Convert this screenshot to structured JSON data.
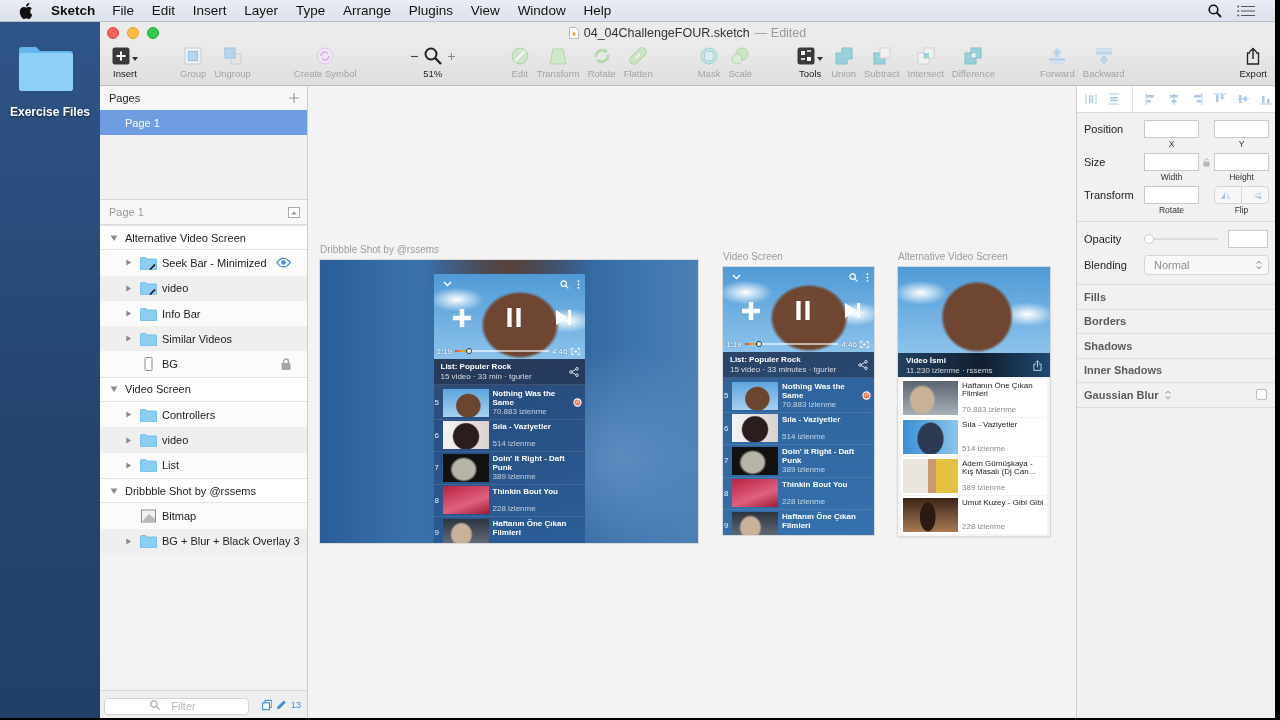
{
  "menu_bar": {
    "app_name": "Sketch",
    "menus": [
      "File",
      "Edit",
      "Insert",
      "Layer",
      "Type",
      "Arrange",
      "Plugins",
      "View",
      "Window",
      "Help"
    ]
  },
  "desktop": {
    "folder_label": "Exercise Files"
  },
  "window": {
    "title": "04_04ChallengeFOUR.sketch",
    "status": "— Edited"
  },
  "toolbar": {
    "groups": [
      {
        "items": [
          {
            "kind": "button",
            "label": "Insert",
            "disabled": false,
            "dropdown": true
          }
        ]
      },
      {
        "items": [
          {
            "kind": "button",
            "label": "Group",
            "disabled": true,
            "dropdown": false
          },
          {
            "kind": "button",
            "label": "Ungroup",
            "disabled": true,
            "dropdown": false
          }
        ]
      },
      {
        "items": [
          {
            "kind": "button",
            "label": "Create Symbol",
            "disabled": true,
            "dropdown": false
          }
        ]
      },
      {
        "items": [
          {
            "kind": "zoom",
            "label": "51%"
          }
        ]
      },
      {
        "items": [
          {
            "kind": "button",
            "label": "Edit",
            "disabled": true,
            "dropdown": false
          },
          {
            "kind": "button",
            "label": "Transform",
            "disabled": true,
            "dropdown": false
          },
          {
            "kind": "button",
            "label": "Rotate",
            "disabled": true,
            "dropdown": false
          },
          {
            "kind": "button",
            "label": "Flatten",
            "disabled": true,
            "dropdown": false
          }
        ]
      },
      {
        "items": [
          {
            "kind": "button",
            "label": "Mask",
            "disabled": true,
            "dropdown": false
          },
          {
            "kind": "button",
            "label": "Scale",
            "disabled": true,
            "dropdown": false
          }
        ]
      },
      {
        "items": [
          {
            "kind": "button",
            "label": "Tools",
            "disabled": false,
            "dropdown": true
          },
          {
            "kind": "button",
            "label": "Union",
            "disabled": true,
            "dropdown": false
          },
          {
            "kind": "button",
            "label": "Subtract",
            "disabled": true,
            "dropdown": false
          },
          {
            "kind": "button",
            "label": "Intersect",
            "disabled": true,
            "dropdown": false
          },
          {
            "kind": "button",
            "label": "Difference",
            "disabled": true,
            "dropdown": false
          }
        ]
      },
      {
        "items": [
          {
            "kind": "button",
            "label": "Forward",
            "disabled": true,
            "dropdown": false
          },
          {
            "kind": "button",
            "label": "Backward",
            "disabled": true,
            "dropdown": false
          }
        ]
      },
      {
        "items": [
          {
            "kind": "button",
            "label": "Export",
            "disabled": false,
            "dropdown": false
          }
        ]
      }
    ]
  },
  "left_panel": {
    "pages_header": "Pages",
    "pages": [
      {
        "name": "Page 1",
        "selected": true
      }
    ],
    "layers_header": "Page 1",
    "layers": [
      {
        "name": "Alternative Video Screen",
        "kind": "artboard",
        "expanded": true,
        "children": [
          {
            "name": "Seek Bar - Minimized",
            "kind": "group",
            "expanded": false,
            "edit_mark": true,
            "locked": false,
            "hovered": true
          },
          {
            "name": "video",
            "kind": "group",
            "expanded": false,
            "edit_mark": true,
            "locked": false,
            "hovered": false
          },
          {
            "name": "Info Bar",
            "kind": "group",
            "expanded": false,
            "edit_mark": false,
            "locked": false,
            "hovered": false
          },
          {
            "name": "Similar Videos",
            "kind": "group",
            "expanded": false,
            "edit_mark": false,
            "locked": false,
            "hovered": false
          },
          {
            "name": "BG",
            "kind": "rectangle",
            "locked": true,
            "hovered": false
          }
        ]
      },
      {
        "name": "Video Screen",
        "kind": "artboard",
        "expanded": true,
        "children": [
          {
            "name": "Controllers",
            "kind": "group",
            "expanded": false,
            "edit_mark": false,
            "locked": false,
            "hovered": false
          },
          {
            "name": "video",
            "kind": "group",
            "expanded": false,
            "edit_mark": false,
            "locked": false,
            "hovered": false
          },
          {
            "name": "List",
            "kind": "group",
            "expanded": false,
            "edit_mark": false,
            "locked": false,
            "hovered": false
          }
        ]
      },
      {
        "name": "Dribbble Shot by @rssems",
        "kind": "artboard",
        "expanded": true,
        "children": [
          {
            "name": "Bitmap",
            "kind": "bitmap",
            "locked": false,
            "hovered": false
          },
          {
            "name": "BG + Blur + Black Overlay 3",
            "kind": "group",
            "expanded": false,
            "edit_mark": false,
            "locked": false,
            "hovered": false
          }
        ]
      }
    ],
    "filter": {
      "placeholder": "Filter",
      "count": "13"
    }
  },
  "canvas": {
    "artboards": [
      {
        "label": "Dribbble Shot by @rssems",
        "kind": "dribbble",
        "screen": {
          "time_elapsed": "1:19",
          "time_total": "4:46",
          "seek": {
            "level": 0.15
          },
          "playlist_title": "List: Populer Rock",
          "playlist_meta": "15 video · 33 min · tgurler",
          "items": [
            {
              "number": "5",
              "title": "Nothing Was the Same",
              "views": "70.883 izlenme",
              "playing": true
            },
            {
              "number": "6",
              "title": "Sıla - Vaziyetler",
              "views": "514 izlenme",
              "playing": false
            },
            {
              "number": "7",
              "title": "Doin' It Right - Daft Punk",
              "views": "389 izlenme",
              "playing": false
            },
            {
              "number": "8",
              "title": "Thinkin Bout You",
              "views": "228 izlenme",
              "playing": false
            },
            {
              "number": "9",
              "title": "Haftanın Öne Çıkan Filmleri",
              "playing": false
            }
          ]
        }
      },
      {
        "label": "Video Screen",
        "kind": "player",
        "screen": {
          "time_elapsed": "1:19",
          "time_total": "4:46",
          "seek": {
            "level": 0.15
          },
          "playlist_title": "List: Populer Rock",
          "playlist_meta": "15 video · 33 minutes · tgurler",
          "items": [
            {
              "number": "5",
              "title": "Nothing Was the Same",
              "views": "70.883 izlenme",
              "playing": true
            },
            {
              "number": "6",
              "title": "Sıla - Vaziyetler",
              "views": "514 izlenme",
              "playing": false
            },
            {
              "number": "7",
              "title": "Doin' it Right - Daft Punk",
              "views": "389 izlenme",
              "playing": false
            },
            {
              "number": "8",
              "title": "Thinkin Bout You",
              "views": "228 izlenme",
              "playing": false
            },
            {
              "number": "9",
              "title": "Haftanın Öne Çıkan Filmleri",
              "playing": false
            }
          ]
        }
      },
      {
        "label": "Alternative Video Screen",
        "kind": "alternative",
        "screen": {
          "video_title": "Video İsmi",
          "video_meta": "11.230 izlenme · rssems",
          "items": [
            {
              "title": "Haftanın Öne Çıkan Filmleri",
              "views": "70.883 izlenme"
            },
            {
              "title": "Sıla - Vaziyetler",
              "views": "514 izlenme"
            },
            {
              "title": "Adem Gümüşkaya - Kış Masalı (Dj Can...",
              "views": "389 izlenme"
            },
            {
              "title": "Umut Kuzey - Gibi Gibi",
              "views": "228 izlenme"
            }
          ]
        }
      }
    ]
  },
  "inspector": {
    "position": {
      "label": "Position",
      "x_label": "X",
      "y_label": "Y"
    },
    "size": {
      "label": "Size",
      "width_label": "Width",
      "height_label": "Height"
    },
    "transform": {
      "label": "Transform",
      "rotate_label": "Rotate",
      "flip_label": "Flip"
    },
    "opacity": {
      "label": "Opacity",
      "level": 0
    },
    "blending": {
      "label": "Blending",
      "value": "Normal"
    },
    "sections": [
      {
        "label": "Fills",
        "kind": "plain"
      },
      {
        "label": "Borders",
        "kind": "plain"
      },
      {
        "label": "Shadows",
        "kind": "plain"
      },
      {
        "label": "Inner Shadows",
        "kind": "plain"
      },
      {
        "label": "Gaussian Blur",
        "kind": "toggle",
        "checked": false
      }
    ]
  }
}
